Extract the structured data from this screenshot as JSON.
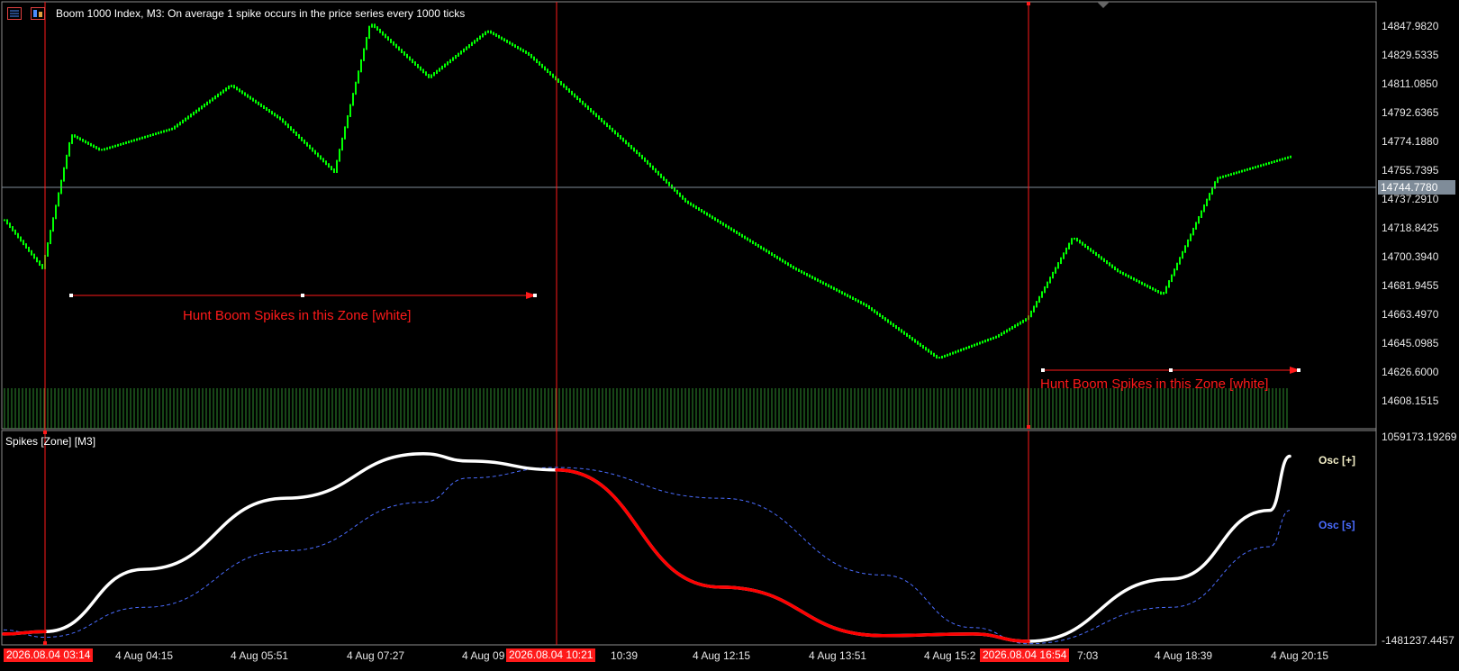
{
  "colors": {
    "background": "#000000",
    "candles": "#00ff00",
    "volume": "#2e8b2e",
    "marker": "#ff1a1a",
    "osc_plus": "#ffffff",
    "osc_minus": "#ff0000",
    "osc_signal": "#4a6cff",
    "price_line": "#7f8c99"
  },
  "header": {
    "menu_icon": "chart-list-icon",
    "indicator_icon": "indicator-icon",
    "title": "Boom 1000 Index, M3:  On average 1 spike occurs in the price series every 1000 ticks"
  },
  "price_axis": {
    "labels": [
      "14847.9820",
      "14829.5335",
      "14811.0850",
      "14792.6365",
      "14774.1880",
      "14755.7395",
      "14737.2910",
      "14718.8425",
      "14700.3940",
      "14681.9455",
      "14663.4970",
      "14645.0985",
      "14626.6000",
      "14608.1515"
    ],
    "current_price": "14744.7780"
  },
  "zones": [
    {
      "label": "Hunt Boom Spikes in this Zone [white]"
    },
    {
      "label": "Hunt Boom Spikes in this Zone [white]"
    }
  ],
  "subwindow": {
    "title": "Spikes [Zone] [M3]",
    "axis_top": "1059173.19269",
    "axis_bottom": "-1481237.4457",
    "legend_plus": "Osc [+]",
    "legend_s": "Osc [s]"
  },
  "time_axis": {
    "labels": [
      "4 Aug 04:15",
      "4 Aug 05:51",
      "4 Aug 07:27",
      "4 Aug 09",
      "10:39",
      "4 Aug 12:15",
      "4 Aug 13:51",
      "4 Aug 15:2",
      "7:03",
      "4 Aug 18:39",
      "4 Aug 20:15"
    ],
    "markers": [
      "2026.08.04 03:14",
      "2026.08.04 10:21",
      "2026.08.04 16:54"
    ]
  },
  "chart_data": {
    "type": "line",
    "title": "Boom 1000 Index, M3",
    "price_series": {
      "x": [
        "04:00",
        "03:14",
        "03:40",
        "04:15",
        "05:00",
        "05:51",
        "06:40",
        "07:27",
        "08:10",
        "09:00",
        "10:21",
        "11:00",
        "12:15",
        "13:00",
        "13:51",
        "14:40",
        "15:20",
        "16:54",
        "17:20",
        "18:00",
        "18:39",
        "19:30",
        "20:15",
        "20:40"
      ],
      "values": [
        14723,
        14692,
        14778,
        14768,
        14782,
        14810,
        14788,
        14754,
        14850,
        14815,
        14845,
        14830,
        14764,
        14735,
        14692,
        14668,
        14634,
        14648,
        14660,
        14712,
        14690,
        14675,
        14750,
        14764
      ]
    },
    "oscillator": {
      "x": [
        "03:00",
        "03:14",
        "04:15",
        "05:51",
        "07:27",
        "09:00",
        "10:21",
        "12:15",
        "13:51",
        "15:20",
        "16:54",
        "18:39",
        "20:15",
        "20:40"
      ],
      "osc": [
        -1380000,
        -1350000,
        -580000,
        300000,
        850000,
        760000,
        650000,
        -800000,
        -1400000,
        -1380000,
        -1470000,
        -700000,
        150000,
        820000
      ],
      "signal": [
        -1330000,
        -1420000,
        -1050000,
        -350000,
        250000,
        550000,
        680000,
        300000,
        -650000,
        -1300000,
        -1500000,
        -1050000,
        -300000,
        150000
      ]
    }
  }
}
